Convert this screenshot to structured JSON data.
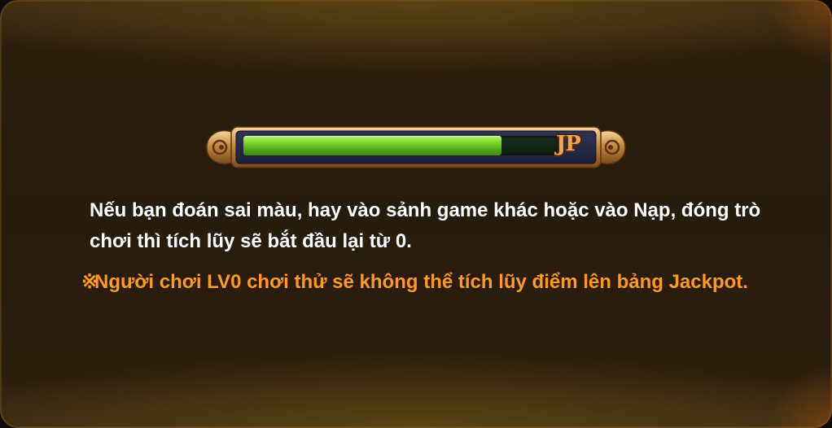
{
  "jackpot_bar": {
    "label": "JP",
    "progress_fraction": 0.82,
    "colors": {
      "fill": "#7bd629",
      "frame": "#d9a45a",
      "label": "#f1a64a"
    }
  },
  "notice": {
    "text": "Nếu bạn đoán sai màu, hay vào sảnh game khác hoặc vào Nạp, đóng trò chơi thì tích lũy sẽ bắt đầu lại từ 0."
  },
  "warning": {
    "mark": "※",
    "text": "Người chơi LV0 chơi thử sẽ không thể tích lũy điểm lên bảng Jackpot.",
    "color": "#ff9a1f"
  }
}
